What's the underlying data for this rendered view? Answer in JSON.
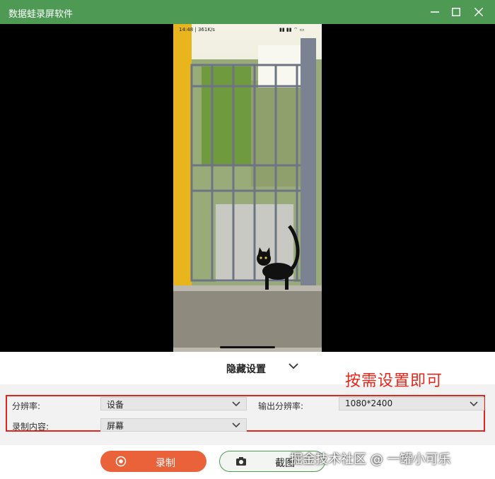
{
  "window": {
    "title": "数据蛙录屏软件"
  },
  "phone_status": {
    "left": "14:48 | 361K/s",
    "right": ""
  },
  "settings": {
    "toggle_label": "隐藏设置",
    "resolution_label": "分辨率:",
    "resolution_value": "设备",
    "output_resolution_label": "输出分辨率:",
    "output_resolution_value": "1080*2400",
    "content_label": "录制内容:",
    "content_value": "屏幕"
  },
  "annotation": "按需设置即可",
  "actions": {
    "record_label": "录制",
    "screenshot_label": "截图"
  },
  "watermark": "掘金技术社区 @ 一罐小可乐",
  "colors": {
    "titlebar": "#4e9a55",
    "record": "#e9623a",
    "annotation": "#e8261c"
  }
}
